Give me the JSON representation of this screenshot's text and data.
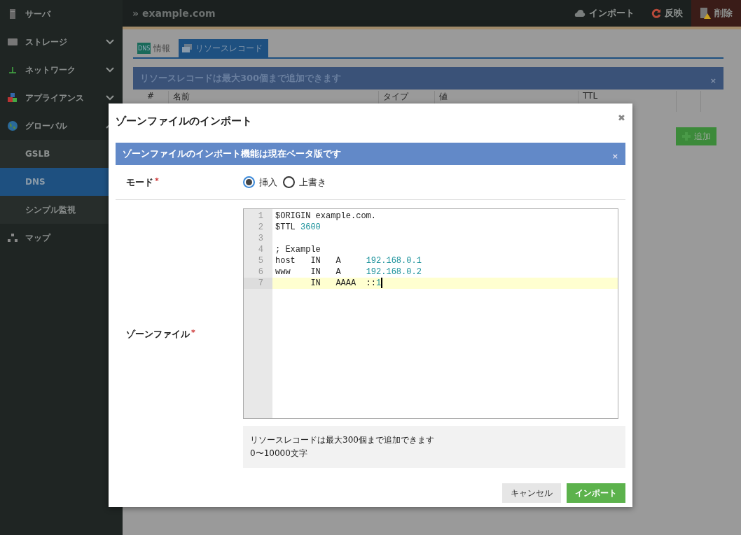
{
  "sidebar": {
    "items": [
      {
        "label": "サーバ",
        "kind": "server"
      },
      {
        "label": "ストレージ",
        "kind": "disk",
        "expanded": false
      },
      {
        "label": "ネットワーク",
        "kind": "network",
        "expanded": false
      },
      {
        "label": "アプライアンス",
        "kind": "blocks",
        "expanded": false
      },
      {
        "label": "グローバル",
        "kind": "globe",
        "expanded": true,
        "children": [
          {
            "label": "GSLB",
            "selected": false
          },
          {
            "label": "DNS",
            "selected": true
          },
          {
            "label": "シンプル監視",
            "selected": false
          }
        ]
      },
      {
        "label": "マップ",
        "kind": "map"
      }
    ]
  },
  "header": {
    "breadcrumb": "» example.com",
    "actions": [
      {
        "label": "インポート",
        "kind": "import"
      },
      {
        "label": "反映",
        "kind": "apply"
      },
      {
        "label": "削除",
        "kind": "delete"
      }
    ]
  },
  "tabs": [
    {
      "label": "情報",
      "kind": "info",
      "badge": "DNS",
      "selected": false
    },
    {
      "label": "リソースレコード",
      "kind": "records",
      "selected": true
    }
  ],
  "notice": {
    "text": "リソースレコードは最大300個まで追加できます",
    "close": "×"
  },
  "table": {
    "columns": [
      "#",
      "名前",
      "タイプ",
      "値",
      "TTL"
    ],
    "add_button": "追加"
  },
  "dialog": {
    "title": "ゾーンファイルのインポート",
    "close": "✖",
    "alert": {
      "text": "ゾーンファイルのインポート機能は現在ベータ版です",
      "close": "×"
    },
    "mode": {
      "label": "モード",
      "required": "*",
      "options": [
        {
          "label": "挿入",
          "selected": true
        },
        {
          "label": "上書き",
          "selected": false
        }
      ]
    },
    "zone_file": {
      "label": "ゾーンファイル",
      "required": "*",
      "lines": [
        {
          "number": "1",
          "active": false,
          "tokens": [
            {
              "text": "$ORIGIN example.com.",
              "kind": "plain"
            }
          ]
        },
        {
          "number": "2",
          "active": false,
          "tokens": [
            {
              "text": "$TTL ",
              "kind": "plain"
            },
            {
              "text": "3600",
              "kind": "number"
            }
          ]
        },
        {
          "number": "3",
          "active": false
        },
        {
          "number": "4",
          "active": false,
          "tokens": [
            {
              "text": "; Example",
              "kind": "plain"
            }
          ]
        },
        {
          "number": "5",
          "active": false,
          "tokens": [
            {
              "text": "host   IN   A     ",
              "kind": "plain"
            },
            {
              "text": "192.168.0.1",
              "kind": "number"
            }
          ]
        },
        {
          "number": "6",
          "active": false,
          "tokens": [
            {
              "text": "www    IN   A     ",
              "kind": "plain"
            },
            {
              "text": "192.168.0.2",
              "kind": "number"
            }
          ]
        },
        {
          "number": "7",
          "active": true,
          "tokens": [
            {
              "text": "       IN   AAAA  ::",
              "kind": "plain"
            },
            {
              "text": "1",
              "kind": "number"
            }
          ]
        }
      ],
      "help": [
        "リソースレコードは最大300個まで追加できます",
        "0〜10000文字"
      ]
    },
    "buttons": [
      {
        "label": "キャンセル",
        "kind": "secondary"
      },
      {
        "label": "インポート",
        "kind": "primary"
      }
    ]
  }
}
